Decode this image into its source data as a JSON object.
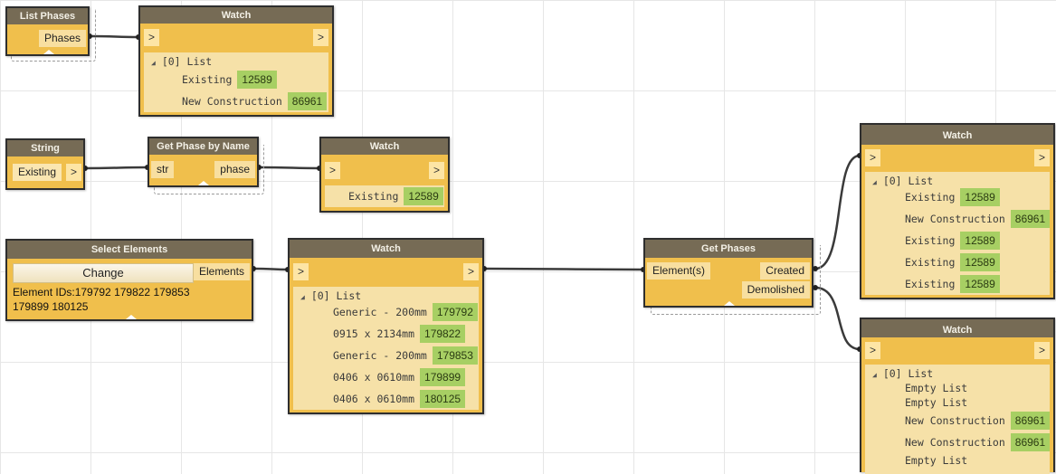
{
  "nodes": {
    "list_phases": {
      "title": "List Phases",
      "out_port": "Phases"
    },
    "watch1": {
      "title": "Watch",
      "in_arrow": ">",
      "out_arrow": ">",
      "list_label": "[0] List",
      "items": [
        {
          "label": "Existing",
          "value": "12589"
        },
        {
          "label": "New Construction",
          "value": "86961"
        }
      ]
    },
    "string": {
      "title": "String",
      "value": "Existing",
      "out_arrow": ">"
    },
    "get_phase_by_name": {
      "title": "Get Phase by Name",
      "in_port": "str",
      "out_port": "phase"
    },
    "watch2": {
      "title": "Watch",
      "in_arrow": ">",
      "out_arrow": ">",
      "items": [
        {
          "label": "Existing",
          "value": "12589"
        }
      ]
    },
    "select_elements": {
      "title": "Select Elements",
      "button_label": "Change",
      "out_port": "Elements",
      "ids_line1": "Element IDs:179792 179822 179853",
      "ids_line2": "179899 180125"
    },
    "watch3": {
      "title": "Watch",
      "in_arrow": ">",
      "out_arrow": ">",
      "list_label": "[0] List",
      "items": [
        {
          "label": "Generic - 200mm",
          "value": "179792"
        },
        {
          "label": "0915 x 2134mm",
          "value": "179822"
        },
        {
          "label": "Generic - 200mm",
          "value": "179853"
        },
        {
          "label": "0406 x 0610mm",
          "value": "179899"
        },
        {
          "label": "0406 x 0610mm",
          "value": "180125"
        }
      ]
    },
    "get_phases": {
      "title": "Get Phases",
      "in_port": "Element(s)",
      "out_port_1": "Created",
      "out_port_2": "Demolished"
    },
    "watch4": {
      "title": "Watch",
      "in_arrow": ">",
      "out_arrow": ">",
      "list_label": "[0] List",
      "items": [
        {
          "label": "Existing",
          "value": "12589"
        },
        {
          "label": "New Construction",
          "value": "86961"
        },
        {
          "label": "Existing",
          "value": "12589"
        },
        {
          "label": "Existing",
          "value": "12589"
        },
        {
          "label": "Existing",
          "value": "12589"
        }
      ]
    },
    "watch5": {
      "title": "Watch",
      "in_arrow": ">",
      "out_arrow": ">",
      "list_label": "[0] List",
      "items": [
        {
          "label": "Empty List",
          "value": ""
        },
        {
          "label": "Empty List",
          "value": ""
        },
        {
          "label": "New Construction",
          "value": "86961"
        },
        {
          "label": "New Construction",
          "value": "86961"
        },
        {
          "label": "Empty List",
          "value": ""
        }
      ]
    }
  },
  "colors": {
    "node_body": "#f0bf4c",
    "node_header": "#766b55",
    "value_badge": "#a7cf63",
    "watch_body": "#f6e1a8",
    "wire": "#3a3a3a"
  }
}
